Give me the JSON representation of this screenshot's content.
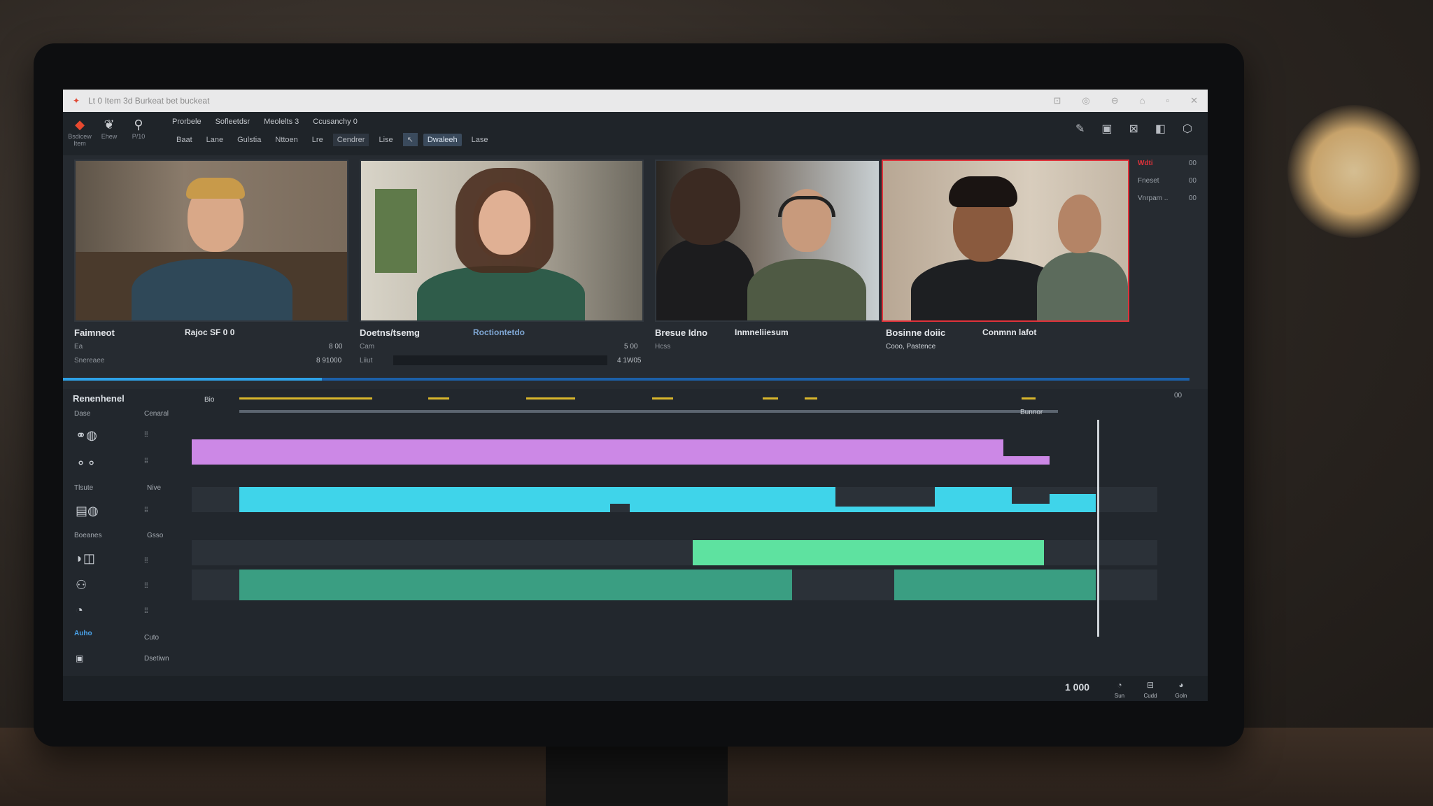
{
  "window": {
    "title": "Lt 0 Item 3d Burkeat bet buckeat"
  },
  "toolbar": {
    "tools": [
      {
        "label": "Bsdicew Item",
        "icon": "app-logo-icon"
      },
      {
        "label": "Ehew",
        "icon": "bird-icon"
      },
      {
        "label": "P/10",
        "icon": "pin-icon"
      }
    ],
    "menu": [
      "Prorbele",
      "Sofleetdsr",
      "Meolelts 3",
      "Ccusanchy 0"
    ],
    "submenu": [
      "Baat",
      "Lane",
      "Gulstia",
      "Nttoen",
      "Lre",
      "Cendrer",
      "Lise",
      "Dwaleeh",
      "Lase"
    ],
    "submenu_selected": "Dwaleeh"
  },
  "clips": [
    {
      "title": "Faimneot",
      "title2": "Rajoc SF 0 0",
      "sub1": "Ea",
      "sub2": "Snereaee",
      "val1": "8 00",
      "val2": "8 91000"
    },
    {
      "title": "Doetns/tsemg",
      "title2": "Roctiontetdo",
      "sub1": "Cam",
      "sub2": "Liiut",
      "val1": "5 00",
      "val2": "4 1W05"
    },
    {
      "title": "Bresue Idno",
      "title2": "Inmneliiesum",
      "sub1": "Hcss",
      "sub2": "",
      "val1": "",
      "val2": ""
    },
    {
      "title": "Bosinne doiic",
      "title2": "Conmnn lafot",
      "sub1": "Cooo, Pastence",
      "sub2": "",
      "val1": "",
      "val2": ""
    }
  ],
  "side_panel": [
    {
      "label": "Wdti",
      "value": "00"
    },
    {
      "label": "Fneset",
      "value": "00"
    },
    {
      "label": "Vnrpam ..",
      "value": "00"
    }
  ],
  "progress": 0.23,
  "timeline": {
    "header": "Renenhenel",
    "ruler_label": "Bio",
    "ruler_end_label": "Bunnor",
    "right_counter": "00",
    "left_labels": [
      "Dase",
      "Tlsute",
      "Boeanes",
      "Auho"
    ],
    "col_labels": [
      "Cenaral",
      "Nive",
      "Gsso",
      "Cuto",
      "Dsetiwn"
    ],
    "time": "1 000"
  },
  "footer_controls": [
    "Sun",
    "Cudd",
    "Goln"
  ],
  "colors": {
    "track_purple": "#cc88e6",
    "track_cyan": "#3fd4ea",
    "track_green_light": "#5ee2a0",
    "track_green_dark": "#3a9e82",
    "accent_red": "#e0323a",
    "progress_blue": "#2ea2e8"
  }
}
